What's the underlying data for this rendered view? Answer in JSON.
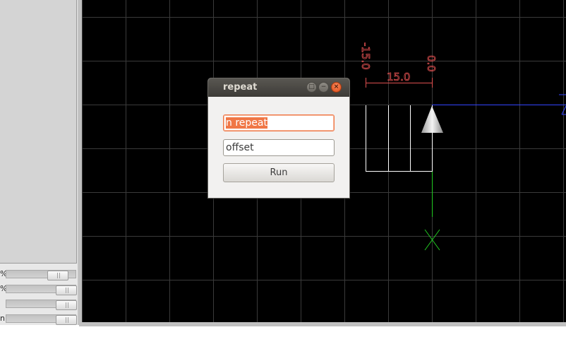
{
  "left_panel": {
    "sliders": [
      {
        "label": "%",
        "level_fraction": 0.82
      },
      {
        "label": "%",
        "level_fraction": 0.95
      },
      {
        "label": "",
        "level_fraction": 0.95
      },
      {
        "label": "n",
        "level_fraction": 0.95
      }
    ]
  },
  "canvas": {
    "background": "#000000",
    "grid_color": "#3a3a3a",
    "dimensions": {
      "left_vertical": "-15.0",
      "right_vertical": "0.0",
      "horizontal": "15.0",
      "color": "#e05050"
    },
    "axis_colors": {
      "x_axis": "#3344ff",
      "y_axis": "#22cc22"
    }
  },
  "dialog": {
    "title": "repeat",
    "n_repeat_value": "n repeat",
    "offset_value": "offset",
    "run_label": "Run",
    "accent_color": "#f07746"
  }
}
